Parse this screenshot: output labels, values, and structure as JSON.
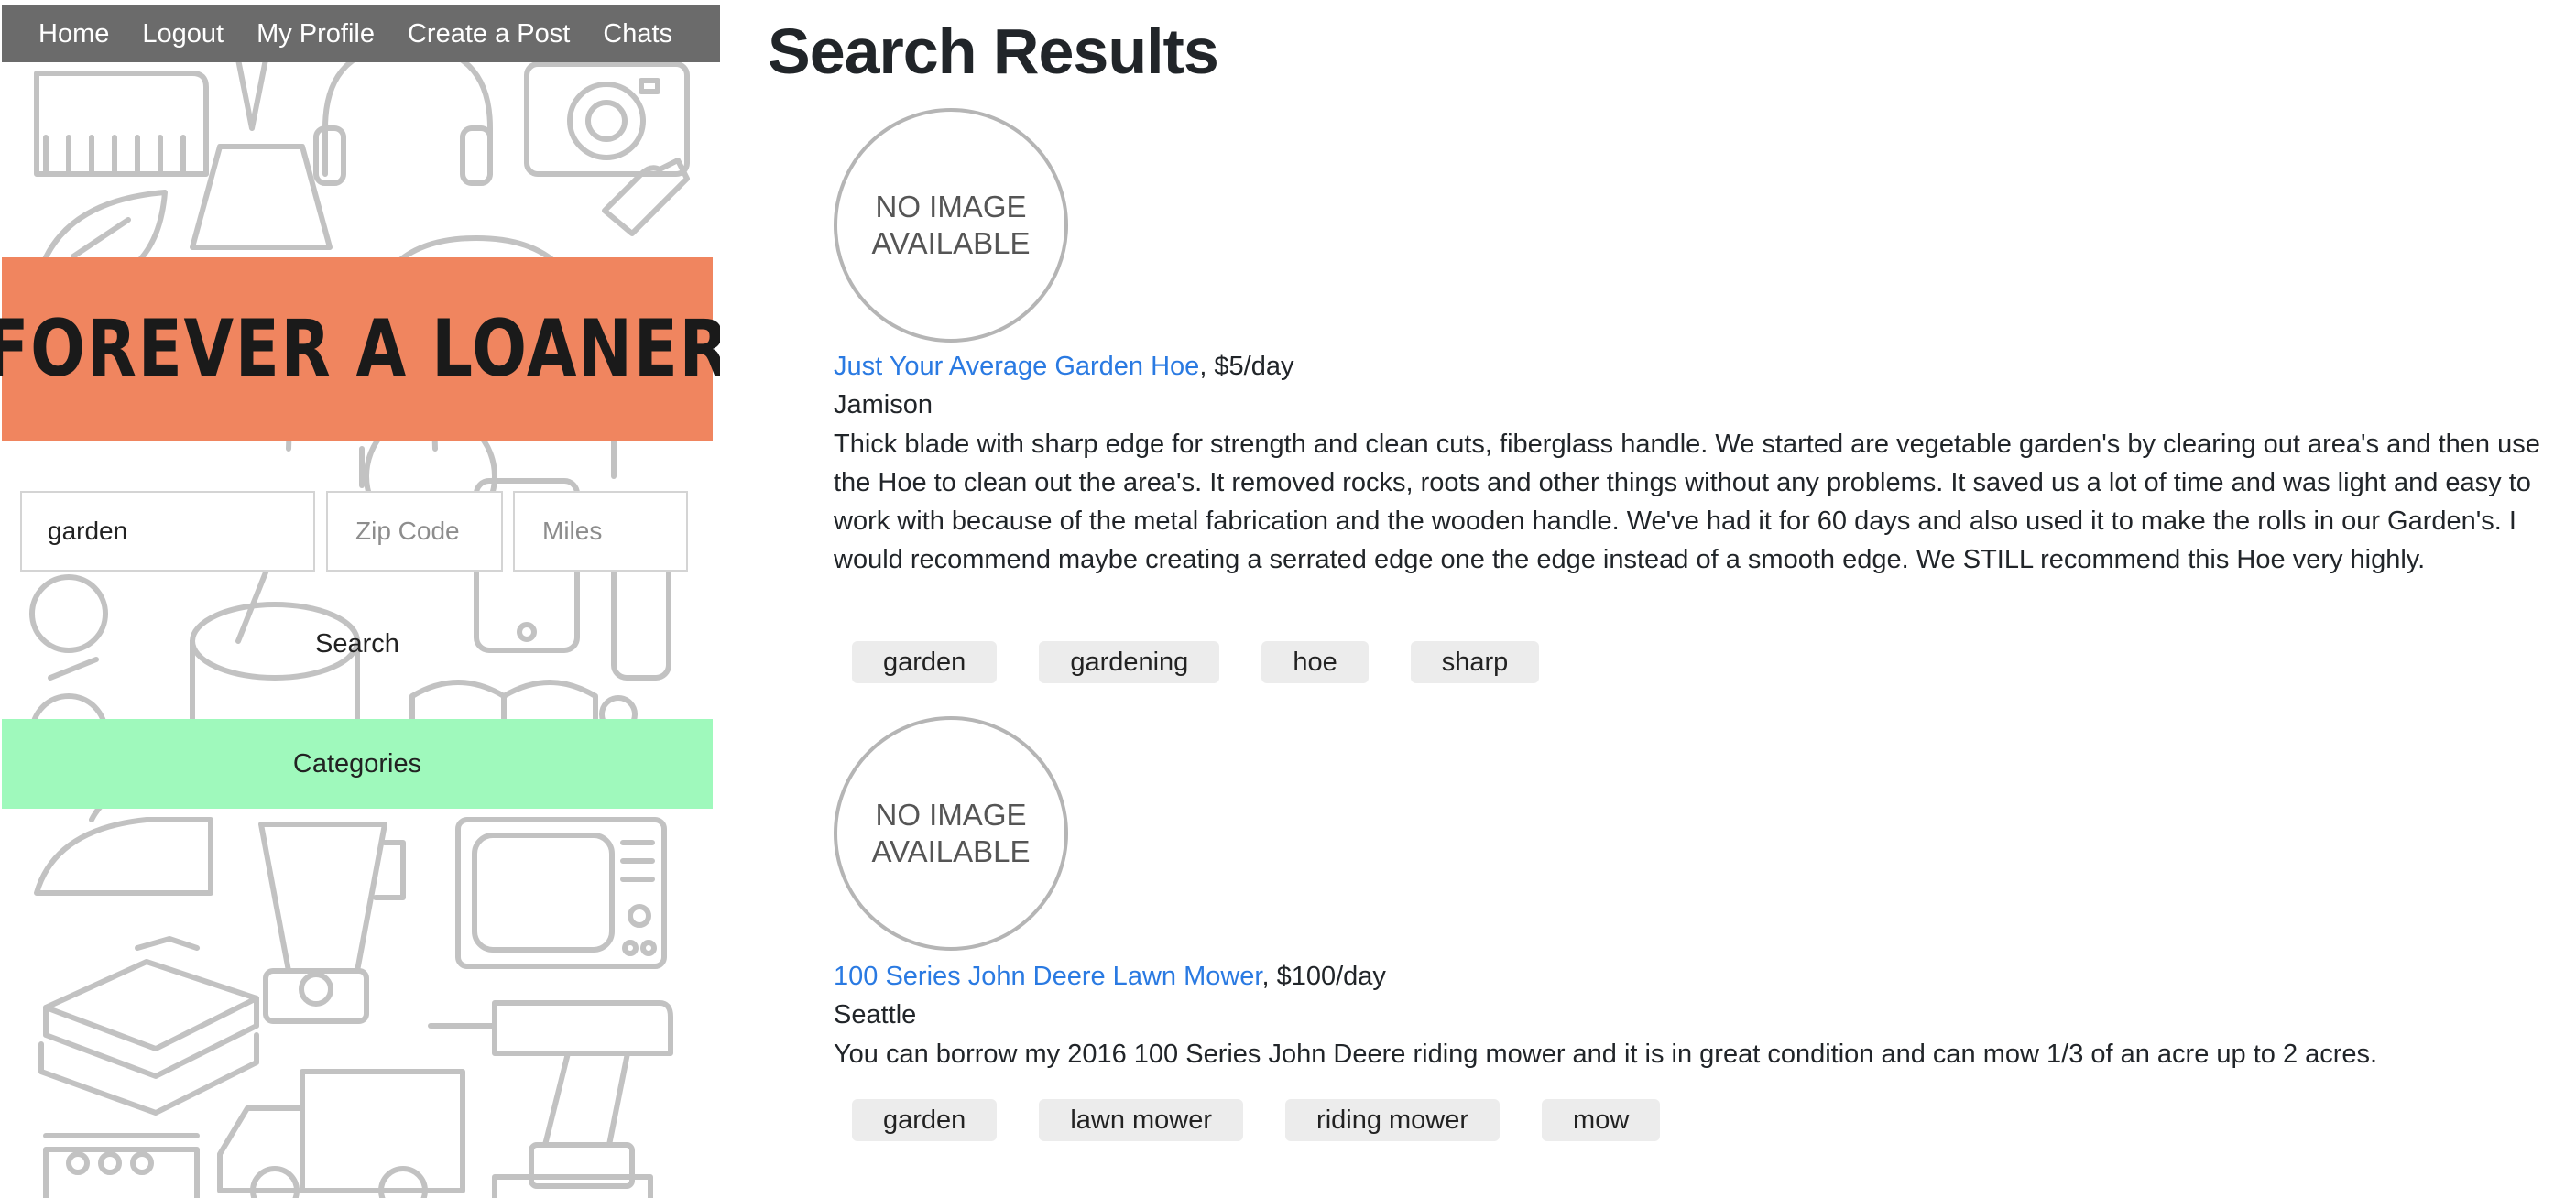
{
  "nav": {
    "items": [
      "Home",
      "Logout",
      "My Profile",
      "Create a Post",
      "Chats"
    ]
  },
  "brand": {
    "title": "FOREVER A LOANER",
    "banner_color": "#f0855f"
  },
  "search": {
    "query_value": "garden",
    "zip_placeholder": "Zip Code",
    "miles_placeholder": "Miles",
    "button_label": "Search"
  },
  "categories": {
    "label": "Categories",
    "color": "#9ff9bc"
  },
  "main": {
    "title": "Search Results",
    "results": [
      {
        "image_text": [
          "NO IMAGE",
          "AVAILABLE"
        ],
        "name": "Just Your Average Garden Hoe",
        "price": ", $5/day",
        "location": "Jamison",
        "description": "Thick blade with sharp edge for strength and clean cuts, fiberglass handle. We started are vegetable garden's by clearing out area's and then use the Hoe to clean out the area's. It removed rocks, roots and other things without any problems. It saved us a lot of time and was light and easy to work with because of the metal fabrication and the wooden handle. We've had it for 60 days and also used it to make the rolls in our Garden's. I would recommend maybe creating a serrated edge one the edge instead of a smooth edge. We STILL recommend this Hoe very highly.",
        "tags": [
          "garden",
          "gardening",
          "hoe",
          "sharp"
        ]
      },
      {
        "image_text": [
          "NO IMAGE",
          "AVAILABLE"
        ],
        "name": "100 Series John Deere Lawn Mower",
        "price": ", $100/day",
        "location": "Seattle",
        "description": "You can borrow my 2016 100 Series John Deere riding mower and it is in great condition and can mow 1/3 of an acre up to 2 acres.",
        "tags": [
          "garden",
          "lawn mower",
          "riding mower",
          "mow"
        ]
      }
    ]
  },
  "colors": {
    "link": "#2a7ae2",
    "nav_bg": "#6b6b6b",
    "tag_bg": "#ececec"
  }
}
